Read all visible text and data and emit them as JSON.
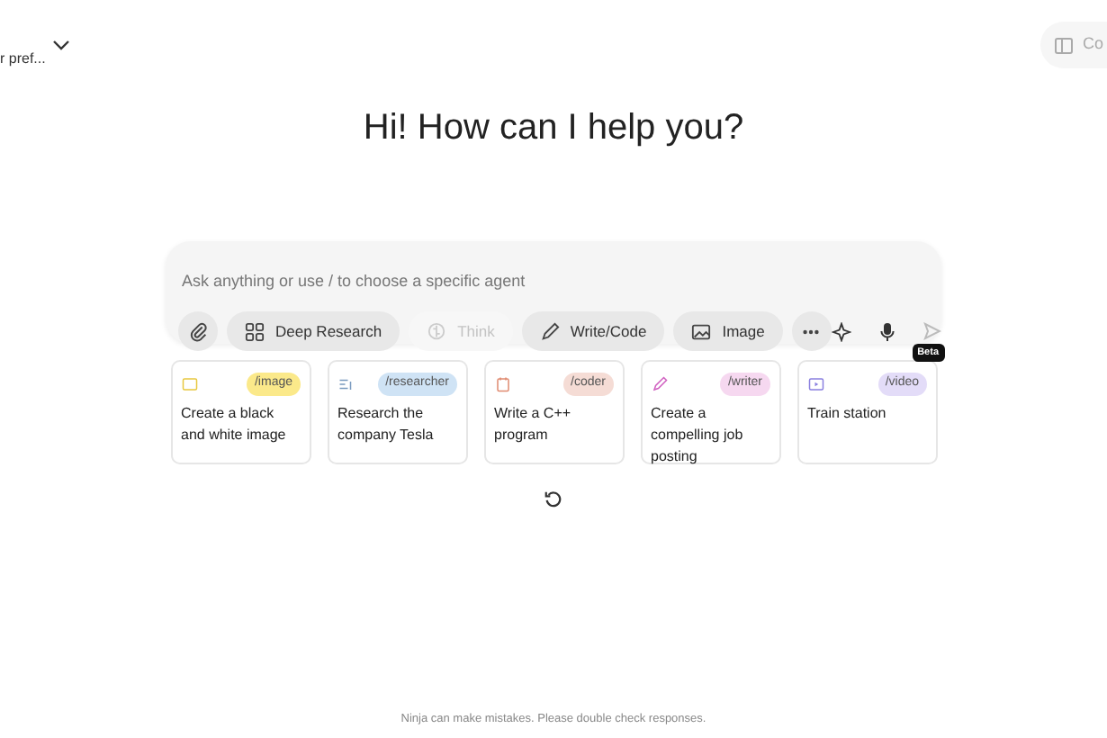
{
  "header": {
    "model_label": "r pref...",
    "panel_button": "Co"
  },
  "greeting": "Hi! How can I help you?",
  "composer": {
    "placeholder": "Ask anything or use / to choose a specific agent",
    "tools": [
      {
        "kind": "attach",
        "disabled": false
      },
      {
        "kind": "research",
        "label": "Deep Research",
        "disabled": false
      },
      {
        "kind": "think",
        "label": "Think",
        "disabled": true
      },
      {
        "kind": "code",
        "label": "Write/Code",
        "disabled": false
      },
      {
        "kind": "image",
        "label": "Image",
        "disabled": false
      },
      {
        "kind": "more",
        "disabled": false
      }
    ]
  },
  "suggestions": [
    {
      "kind": "image",
      "tag": "/image",
      "color": "#fbe98a",
      "text": "Create a black and white image"
    },
    {
      "kind": "researcher",
      "tag": "/researcher",
      "color": "#cfe3f5",
      "text": "Research the company Tesla"
    },
    {
      "kind": "coder",
      "tag": "/coder",
      "color": "#f5dcd5",
      "text": "Write a C++ program"
    },
    {
      "kind": "writer",
      "tag": "/writer",
      "color": "#f6d8f0",
      "text": "Create a compelling job posting"
    },
    {
      "kind": "video",
      "tag": "/video",
      "color": "#e3dcf8",
      "text": "Train station",
      "badge": "Beta"
    }
  ],
  "footer": "Ninja can make mistakes. Please double check responses."
}
